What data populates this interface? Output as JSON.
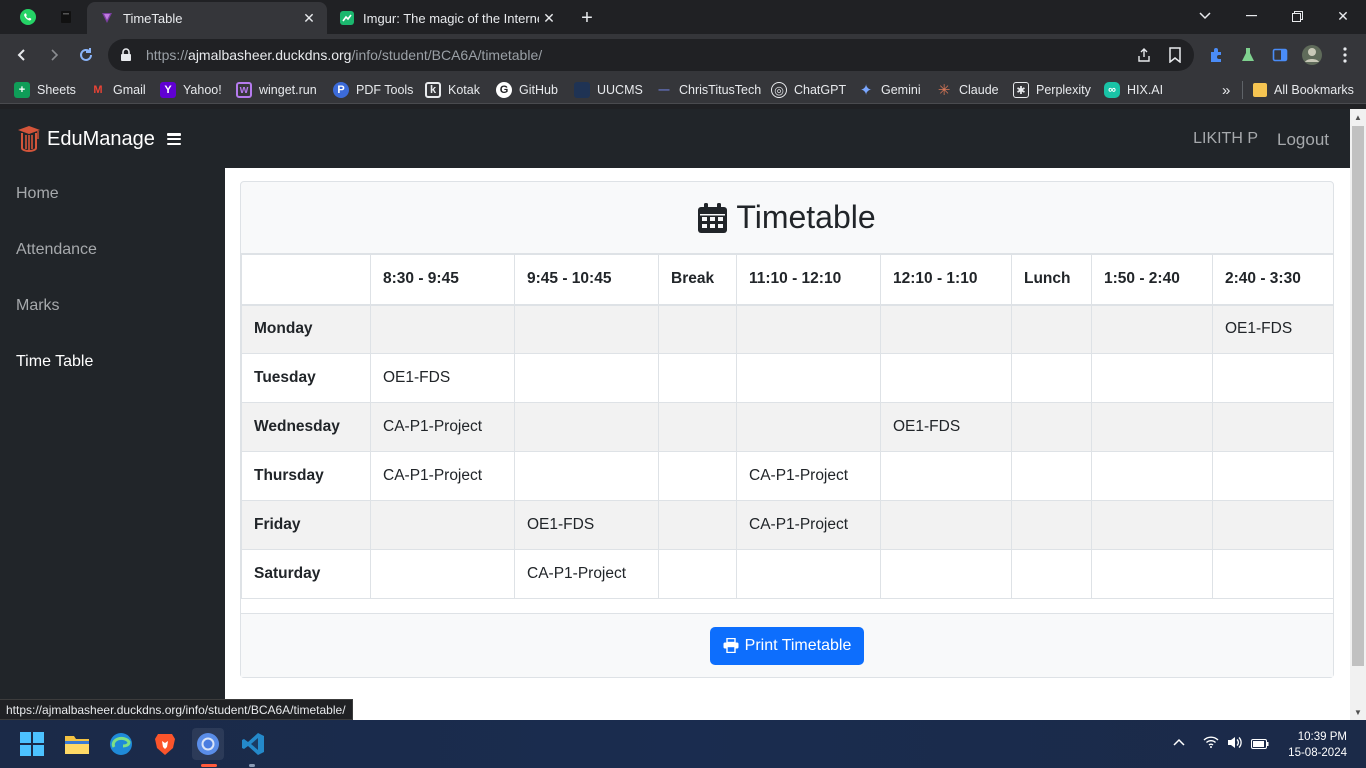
{
  "browser": {
    "tabs": [
      {
        "title": "TimeTable",
        "active": true
      },
      {
        "title": "Imgur: The magic of the Internet",
        "active": false
      }
    ],
    "url_prefix": "https://",
    "url_domain": "ajmalbasheer.duckdns.org",
    "url_path": "/info/student/BCA6A/timetable/",
    "bookmarks": [
      "Sheets",
      "Gmail",
      "Yahoo!",
      "winget.run",
      "PDF Tools",
      "Kotak",
      "GitHub",
      "UUCMS",
      "ChrisTitusTech",
      "ChatGPT",
      "Gemini",
      "Claude",
      "Perplexity",
      "HIX.AI"
    ],
    "all_bookmarks": "All Bookmarks",
    "status_url": "https://ajmalbasheer.duckdns.org/info/student/BCA6A/timetable/"
  },
  "app": {
    "brand": "EduManage",
    "user": "LIKITH P",
    "logout": "Logout",
    "sidebar": [
      "Home",
      "Attendance",
      "Marks",
      "Time Table"
    ],
    "active_sidebar": "Time Table"
  },
  "timetable": {
    "title": "Timetable",
    "headers": [
      "",
      "8:30 - 9:45",
      "9:45 - 10:45",
      "Break",
      "11:10 - 12:10",
      "12:10 - 1:10",
      "Lunch",
      "1:50 - 2:40",
      "2:40 - 3:30"
    ],
    "rows": [
      [
        "Monday",
        "",
        "",
        "",
        "",
        "",
        "",
        "",
        "OE1-FDS"
      ],
      [
        "Tuesday",
        "OE1-FDS",
        "",
        "",
        "",
        "",
        "",
        "",
        ""
      ],
      [
        "Wednesday",
        "CA-P1-Project",
        "",
        "",
        "",
        "OE1-FDS",
        "",
        "",
        ""
      ],
      [
        "Thursday",
        "CA-P1-Project",
        "",
        "",
        "CA-P1-Project",
        "",
        "",
        "",
        ""
      ],
      [
        "Friday",
        "",
        "OE1-FDS",
        "",
        "CA-P1-Project",
        "",
        "",
        "",
        ""
      ],
      [
        "Saturday",
        "",
        "CA-P1-Project",
        "",
        "",
        "",
        "",
        "",
        ""
      ]
    ],
    "print_button": "Print Timetable"
  },
  "taskbar": {
    "time": "10:39 PM",
    "date": "15-08-2024"
  },
  "colors": {
    "primary": "#0d6efd",
    "navbar": "#212529"
  }
}
